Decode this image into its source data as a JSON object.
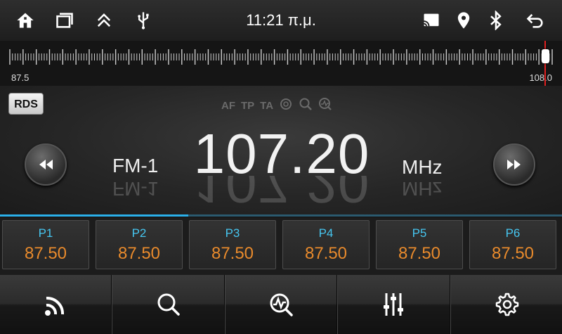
{
  "status_bar": {
    "time": "11:21 π.μ.",
    "left_icons": [
      "home-icon",
      "recent-apps-icon",
      "collapse-up-icon",
      "usb-icon"
    ],
    "right_icons": [
      "screen-cast-icon",
      "location-pin-icon",
      "bluetooth-icon",
      "back-arrow-icon"
    ]
  },
  "tuner_scale": {
    "min_label": "87.5",
    "max_label": "108.0",
    "current_fraction": 0.985
  },
  "radio": {
    "rds_label": "RDS",
    "flags": {
      "af": "AF",
      "tp": "TP",
      "ta": "TA"
    },
    "flag_icons": [
      "stereo-icon",
      "search-icon",
      "scan-icon"
    ],
    "band": "FM-1",
    "frequency": "107.20",
    "unit": "MHz",
    "seek_progress_fraction": 0.335
  },
  "presets": [
    {
      "label": "P1",
      "freq": "87.50"
    },
    {
      "label": "P2",
      "freq": "87.50"
    },
    {
      "label": "P3",
      "freq": "87.50"
    },
    {
      "label": "P4",
      "freq": "87.50"
    },
    {
      "label": "P5",
      "freq": "87.50"
    },
    {
      "label": "P6",
      "freq": "87.50"
    }
  ],
  "toolbar_icons": [
    "radio-signal-icon",
    "search-icon",
    "scan-icon",
    "equalizer-icon",
    "settings-gear-icon"
  ],
  "colors": {
    "preset_label": "#46c6f0",
    "preset_freq": "#e88a2c",
    "progress_accent": "#2bb0ea",
    "tuner_marker": "#e02020"
  }
}
